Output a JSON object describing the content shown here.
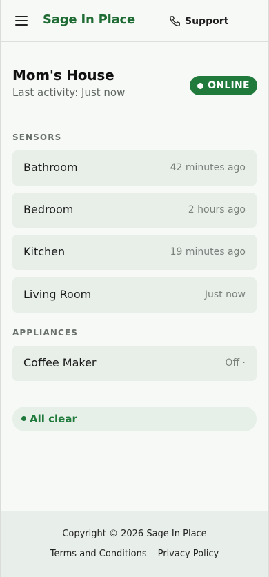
{
  "header": {
    "brand": "Sage In Place",
    "support_label": "Support"
  },
  "house": {
    "name": "Mom's House",
    "last_activity": "Last activity: Just now",
    "status": "ONLINE",
    "status_color": "#1f7a3b"
  },
  "sensors": {
    "title": "SENSORS",
    "items": [
      {
        "name": "Bathroom",
        "time": "42 minutes ago"
      },
      {
        "name": "Bedroom",
        "time": "2 hours ago"
      },
      {
        "name": "Kitchen",
        "time": "19 minutes ago"
      },
      {
        "name": "Living Room",
        "time": "Just now"
      }
    ]
  },
  "appliances": {
    "title": "APPLIANCES",
    "items": [
      {
        "name": "Coffee Maker",
        "status": "Off ·"
      }
    ]
  },
  "alert": {
    "label": "All clear"
  },
  "footer": {
    "copyright": "Copyright © 2026 Sage In Place",
    "terms": "Terms and Conditions",
    "privacy": "Privacy Policy"
  },
  "icons": {
    "menu": "hamburger-menu-icon",
    "support": "phone-icon"
  },
  "colors": {
    "brand": "#1e6b34",
    "card_bg": "#e8efe9",
    "footer_bg": "#e8eee9"
  }
}
